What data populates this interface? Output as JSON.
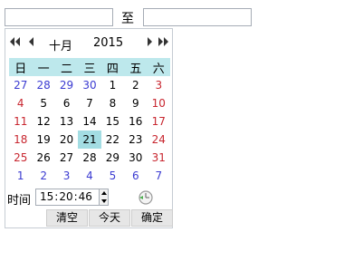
{
  "range": {
    "start_value": "",
    "separator": "至",
    "end_value": ""
  },
  "header": {
    "month": "十月",
    "year": "2015"
  },
  "weekdays": [
    "日",
    "一",
    "二",
    "三",
    "四",
    "五",
    "六"
  ],
  "weeks": [
    [
      "27",
      "28",
      "29",
      "30",
      "1",
      "2",
      "3"
    ],
    [
      "4",
      "5",
      "6",
      "7",
      "8",
      "9",
      "10"
    ],
    [
      "11",
      "12",
      "13",
      "14",
      "15",
      "16",
      "17"
    ],
    [
      "18",
      "19",
      "20",
      "21",
      "22",
      "23",
      "24"
    ],
    [
      "25",
      "26",
      "27",
      "28",
      "29",
      "30",
      "31"
    ],
    [
      "1",
      "2",
      "3",
      "4",
      "5",
      "6",
      "7"
    ]
  ],
  "selected_day": "21",
  "time": {
    "label": "时间",
    "hour": "15",
    "minute": "20",
    "second": "46",
    "separator": ":"
  },
  "buttons": {
    "clear": "清空",
    "today": "今天",
    "ok": "确定"
  },
  "colors": {
    "header_bg": "#bde8ec",
    "selected_bg": "#a3dde3",
    "other_month": "#3b3bd1",
    "weekend": "#c8262f",
    "button_bg": "#e6e6e6"
  },
  "icons": {
    "prev_year": "double-left-arrow-icon",
    "prev_month": "left-arrow-icon",
    "next_month": "right-arrow-icon",
    "next_year": "double-right-arrow-icon",
    "time_now": "clock-icon"
  }
}
